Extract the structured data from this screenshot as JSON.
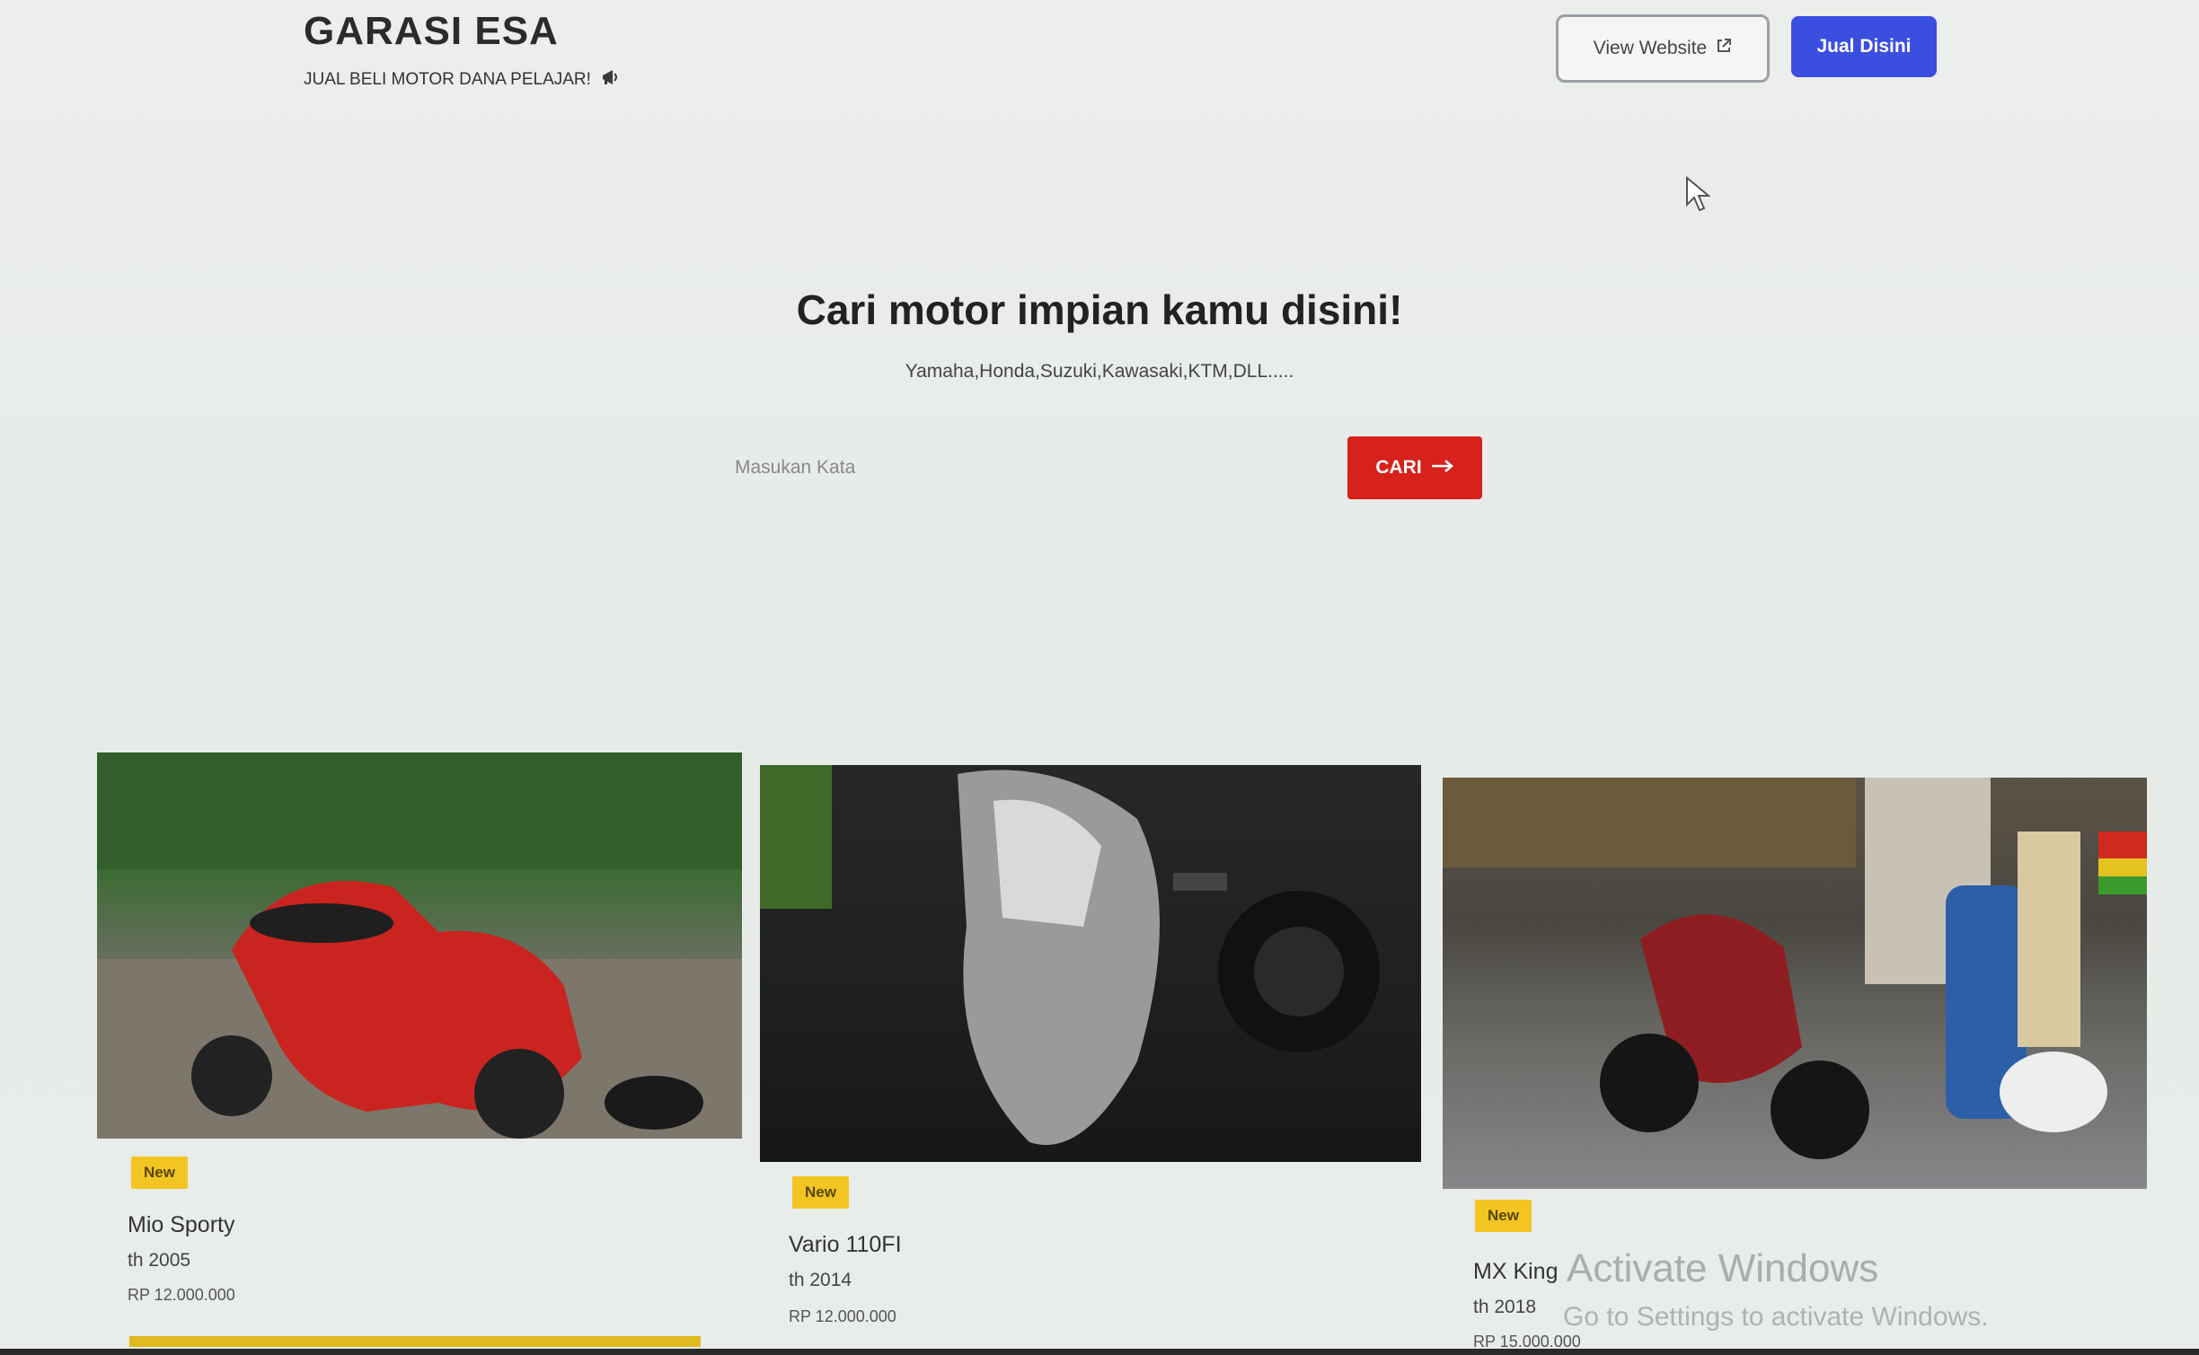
{
  "header": {
    "brand_title": "GARASI ESA",
    "brand_subtitle": "JUAL BELI MOTOR DANA PELAJAR!",
    "brand_icon": "megaphone-icon",
    "view_website_label": "View Website",
    "view_website_icon": "external-link-icon",
    "sell_label": "Jual Disini"
  },
  "hero": {
    "title": "Cari motor impian kamu disini!",
    "subtitle": "Yamaha,Honda,Suzuki,Kawasaki,KTM,DLL.....",
    "search_placeholder": "Masukan Kata",
    "search_button_label": "CARI",
    "search_button_icon": "arrow-right-icon"
  },
  "listings": [
    {
      "badge": "New",
      "name": "Mio Sporty",
      "year": "th 2005",
      "price": "RP 12.000.000"
    },
    {
      "badge": "New",
      "name": "Vario 110FI",
      "year": "th 2014",
      "price": "RP 12.000.000"
    },
    {
      "badge": "New",
      "name": "MX King",
      "year": "th 2018",
      "price": "RP 15.000.000"
    }
  ],
  "os_notice": {
    "line1": "Activate Windows",
    "line2": "Go to Settings to activate Windows."
  },
  "colors": {
    "primary": "#3a4ee0",
    "search_button": "#d8201c",
    "badge": "#f2c523"
  }
}
